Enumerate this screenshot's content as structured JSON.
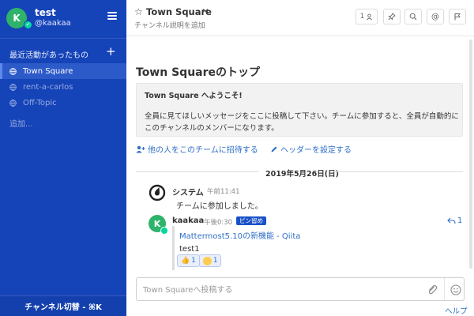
{
  "sidebar": {
    "avatar_letter": "K",
    "team_name": "test",
    "username": "@kaakaa",
    "section_label": "最近活動があったもの",
    "channels": [
      {
        "label": "Town Square",
        "active": true
      },
      {
        "label": "rent-a-carlos",
        "active": false
      },
      {
        "label": "Off-Topic",
        "active": false
      }
    ],
    "more_label": "追加...",
    "switcher_label": "チャンネル切替 - ⌘K"
  },
  "header": {
    "channel_name": "Town Square",
    "purpose_placeholder": "チャンネル説明を追加",
    "member_count": "1",
    "icons": [
      "member-icon",
      "pin-icon",
      "search-icon",
      "mention-icon",
      "flag-icon"
    ]
  },
  "intro": {
    "title": "Town Squareのトップ",
    "welcome": "Town Square へようこそ!",
    "description": "全員に見てほしいメッセージをここに投稿して下さい。チームに参加すると、全員が自動的にこのチャンネルのメンバーになります。",
    "invite_label": "他の人をこのチームに招待する",
    "set_header_label": "ヘッダーを設定する"
  },
  "date_separator": "2019年5月26日(日)",
  "posts": [
    {
      "author": "システム",
      "time": "午前11:41",
      "message": "チームに参加しました。"
    },
    {
      "avatar_letter": "K",
      "author": "kaakaa",
      "time": "午後0:30",
      "badge": "ピン留め",
      "reply_count": "1",
      "link_title": "Mattermost5.10の新機能 - Qiita",
      "message": "test1",
      "reactions": [
        {
          "emoji": "thumbsup",
          "count": "1"
        },
        {
          "emoji": "smile",
          "count": "1"
        }
      ]
    }
  ],
  "composer": {
    "placeholder": "Town Squareへ投稿する",
    "value": ""
  },
  "help_label": "ヘルプ",
  "colors": {
    "sidebar_bg": "#1543b8",
    "active_channel_bg": "#2c5ac8",
    "link": "#2f6fc6",
    "online": "#06d6a0",
    "avatar": "#2fb36b"
  }
}
